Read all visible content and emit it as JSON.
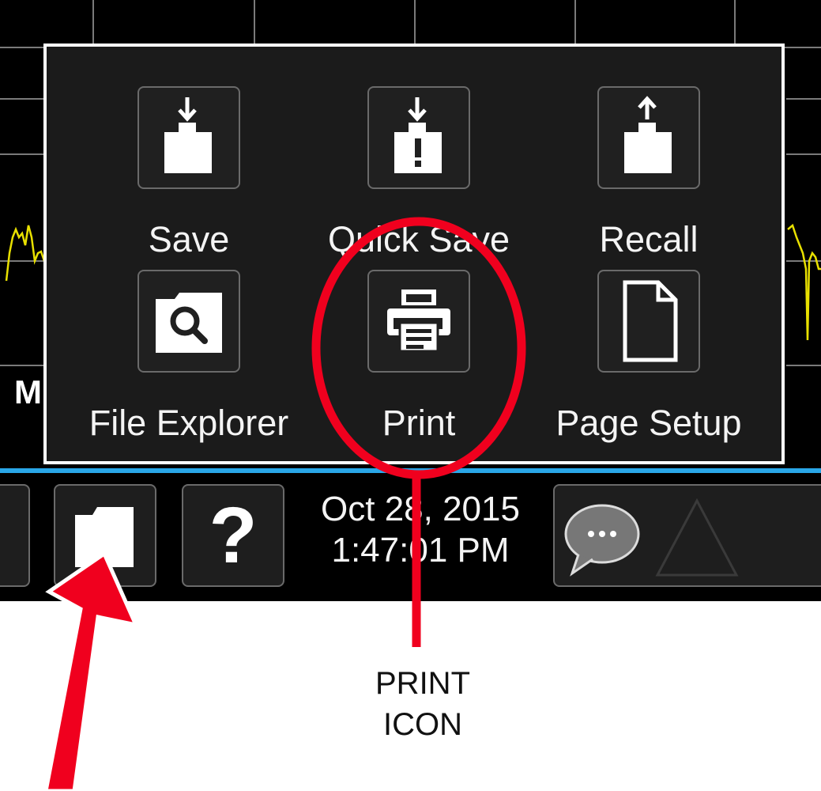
{
  "menu": {
    "items": [
      {
        "label": "Save",
        "icon": "folder-save-icon"
      },
      {
        "label": "Quick Save",
        "icon": "folder-quick-save-icon"
      },
      {
        "label": "Recall",
        "icon": "folder-recall-icon"
      },
      {
        "label": "File Explorer",
        "icon": "folder-search-icon"
      },
      {
        "label": "Print",
        "icon": "printer-icon"
      },
      {
        "label": "Page Setup",
        "icon": "page-icon"
      }
    ]
  },
  "background": {
    "partial_label": "M"
  },
  "toolbar": {
    "date": "Oct 28, 2015",
    "time": "1:47:01 PM",
    "file_icon": "folder-icon",
    "help_icon": "question-mark-icon",
    "help_glyph": "?",
    "message_icon": "speech-bubble-icon",
    "warning_icon": "triangle-icon"
  },
  "annotation": {
    "callout_line1": "PRINT",
    "callout_line2": "ICON"
  },
  "colors": {
    "trace": "#e8e000",
    "accent_bar": "#2aa7e8",
    "annotation_red": "#f0001e"
  }
}
